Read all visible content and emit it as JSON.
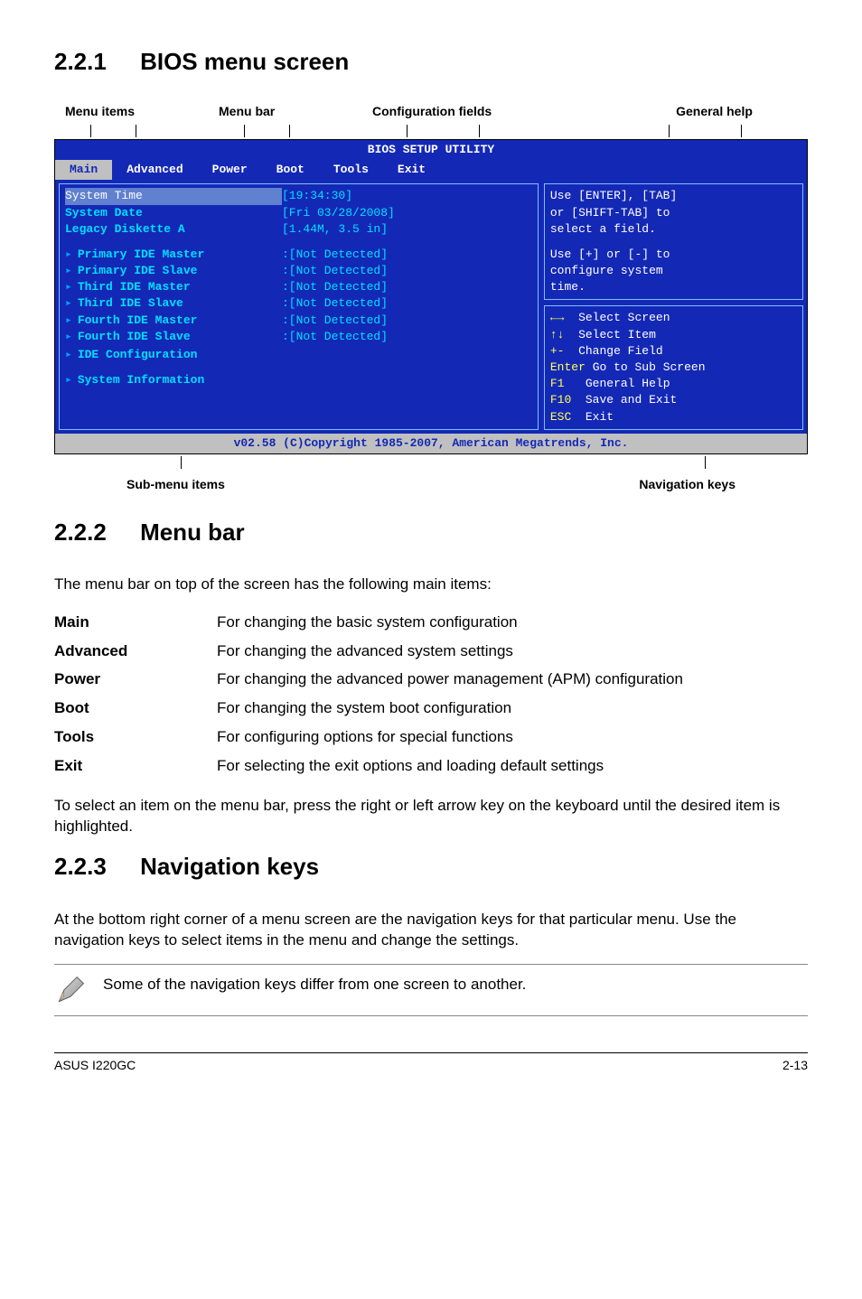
{
  "sections": {
    "s1": {
      "num": "2.2.1",
      "title": "BIOS menu screen"
    },
    "s2": {
      "num": "2.2.2",
      "title": "Menu bar"
    },
    "s3": {
      "num": "2.2.3",
      "title": "Navigation keys"
    }
  },
  "bios_labels": {
    "menu_items": "Menu items",
    "menu_bar": "Menu bar",
    "config_fields": "Configuration fields",
    "general_help": "General help",
    "sub_menu": "Sub-menu items",
    "nav_keys": "Navigation keys"
  },
  "bios": {
    "title": "BIOS SETUP UTILITY",
    "tabs": [
      "Main",
      "Advanced",
      "Power",
      "Boot",
      "Tools",
      "Exit"
    ],
    "left": {
      "system_time_label": "System Time",
      "system_time_value": "[19:34:30]",
      "system_date_label": "System Date",
      "system_date_value": "[Fri 03/28/2008]",
      "legacy_label": "Legacy Diskette A",
      "legacy_value": "[1.44M, 3.5 in]",
      "items": [
        {
          "label": "Primary IDE Master",
          "value": ":[Not Detected]"
        },
        {
          "label": "Primary IDE Slave",
          "value": ":[Not Detected]"
        },
        {
          "label": "Third IDE Master",
          "value": ":[Not Detected]"
        },
        {
          "label": "Third IDE Slave",
          "value": ":[Not Detected]"
        },
        {
          "label": "Fourth IDE Master",
          "value": ":[Not Detected]"
        },
        {
          "label": "Fourth IDE Slave",
          "value": ":[Not Detected]"
        }
      ],
      "ide_config": "IDE Configuration",
      "sys_info": "System Information"
    },
    "help_top": {
      "line1": "Use [ENTER], [TAB]",
      "line2": "or [SHIFT-TAB] to",
      "line3": "select a field.",
      "line4": "Use [+] or [-] to",
      "line5": "configure system",
      "line6": "time."
    },
    "help_bottom": [
      {
        "key": "←→",
        "text": "Select Screen"
      },
      {
        "key": "↑↓",
        "text": "Select Item"
      },
      {
        "key": "+-",
        "text": "Change Field"
      },
      {
        "key": "Enter",
        "text": "Go to Sub Screen"
      },
      {
        "key": "F1",
        "text": "General Help"
      },
      {
        "key": "F10",
        "text": "Save and Exit"
      },
      {
        "key": "ESC",
        "text": "Exit"
      }
    ],
    "footer": "v02.58 (C)Copyright 1985-2007, American Megatrends, Inc."
  },
  "menu_bar_intro": "The menu bar on top of the screen has the following main items:",
  "menu_bar_defs": [
    {
      "k": "Main",
      "v": "For changing the basic system configuration"
    },
    {
      "k": "Advanced",
      "v": "For changing the advanced system settings"
    },
    {
      "k": "Power",
      "v": "For changing the advanced power management (APM) configuration"
    },
    {
      "k": "Boot",
      "v": "For changing the system boot configuration"
    },
    {
      "k": "Tools",
      "v": "For configuring options for special functions"
    },
    {
      "k": "Exit",
      "v": "For selecting the exit options and loading default settings"
    }
  ],
  "menu_bar_footnote": "To select an item on the menu bar, press the right or left arrow key on the keyboard until the desired item is highlighted.",
  "nav_keys_text": "At the bottom right corner of a menu screen are the navigation keys for that particular menu. Use the navigation keys to select items in the menu and change the settings.",
  "note_text": "Some of the navigation keys differ from one screen to another.",
  "footer": {
    "left": "ASUS I220GC",
    "right": "2-13"
  }
}
